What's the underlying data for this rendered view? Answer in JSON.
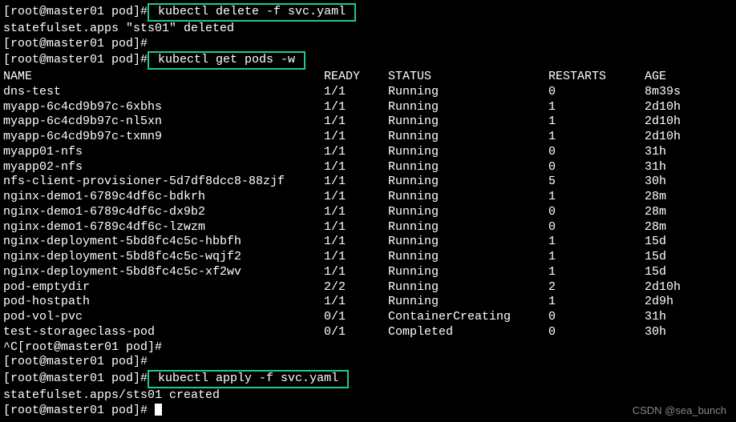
{
  "prompt1": "[root@master01 pod]#",
  "cmd_delete": " kubectl delete -f svc.yaml ",
  "out_delete": "statefulset.apps \"sts01\" deleted",
  "prompt2": "[root@master01 pod]#",
  "prompt3": "[root@master01 pod]#",
  "cmd_get": " kubectl get pods -w ",
  "headers": {
    "name": "NAME",
    "ready": "READY",
    "status": "STATUS",
    "restarts": "RESTARTS",
    "age": "AGE"
  },
  "pods": [
    {
      "name": "dns-test",
      "ready": "1/1",
      "status": "Running",
      "restarts": "0",
      "age": "8m39s"
    },
    {
      "name": "myapp-6c4cd9b97c-6xbhs",
      "ready": "1/1",
      "status": "Running",
      "restarts": "1",
      "age": "2d10h"
    },
    {
      "name": "myapp-6c4cd9b97c-nl5xn",
      "ready": "1/1",
      "status": "Running",
      "restarts": "1",
      "age": "2d10h"
    },
    {
      "name": "myapp-6c4cd9b97c-txmn9",
      "ready": "1/1",
      "status": "Running",
      "restarts": "1",
      "age": "2d10h"
    },
    {
      "name": "myapp01-nfs",
      "ready": "1/1",
      "status": "Running",
      "restarts": "0",
      "age": "31h"
    },
    {
      "name": "myapp02-nfs",
      "ready": "1/1",
      "status": "Running",
      "restarts": "0",
      "age": "31h"
    },
    {
      "name": "nfs-client-provisioner-5d7df8dcc8-88zjf",
      "ready": "1/1",
      "status": "Running",
      "restarts": "5",
      "age": "30h"
    },
    {
      "name": "nginx-demo1-6789c4df6c-bdkrh",
      "ready": "1/1",
      "status": "Running",
      "restarts": "1",
      "age": "28m"
    },
    {
      "name": "nginx-demo1-6789c4df6c-dx9b2",
      "ready": "1/1",
      "status": "Running",
      "restarts": "0",
      "age": "28m"
    },
    {
      "name": "nginx-demo1-6789c4df6c-lzwzm",
      "ready": "1/1",
      "status": "Running",
      "restarts": "0",
      "age": "28m"
    },
    {
      "name": "nginx-deployment-5bd8fc4c5c-hbbfh",
      "ready": "1/1",
      "status": "Running",
      "restarts": "1",
      "age": "15d"
    },
    {
      "name": "nginx-deployment-5bd8fc4c5c-wqjf2",
      "ready": "1/1",
      "status": "Running",
      "restarts": "1",
      "age": "15d"
    },
    {
      "name": "nginx-deployment-5bd8fc4c5c-xf2wv",
      "ready": "1/1",
      "status": "Running",
      "restarts": "1",
      "age": "15d"
    },
    {
      "name": "pod-emptydir",
      "ready": "2/2",
      "status": "Running",
      "restarts": "2",
      "age": "2d10h"
    },
    {
      "name": "pod-hostpath",
      "ready": "1/1",
      "status": "Running",
      "restarts": "1",
      "age": "2d9h"
    },
    {
      "name": "pod-vol-pvc",
      "ready": "0/1",
      "status": "ContainerCreating",
      "restarts": "0",
      "age": "31h"
    },
    {
      "name": "test-storageclass-pod",
      "ready": "0/1",
      "status": "Completed",
      "restarts": "0",
      "age": "30h"
    }
  ],
  "prompt_int": "^C[root@master01 pod]#",
  "prompt4": "[root@master01 pod]#",
  "prompt5": "[root@master01 pod]#",
  "cmd_apply": " kubectl apply -f svc.yaml ",
  "out_apply": "statefulset.apps/sts01 created",
  "prompt6": "[root@master01 pod]# ",
  "watermark": "CSDN @sea_bunch"
}
